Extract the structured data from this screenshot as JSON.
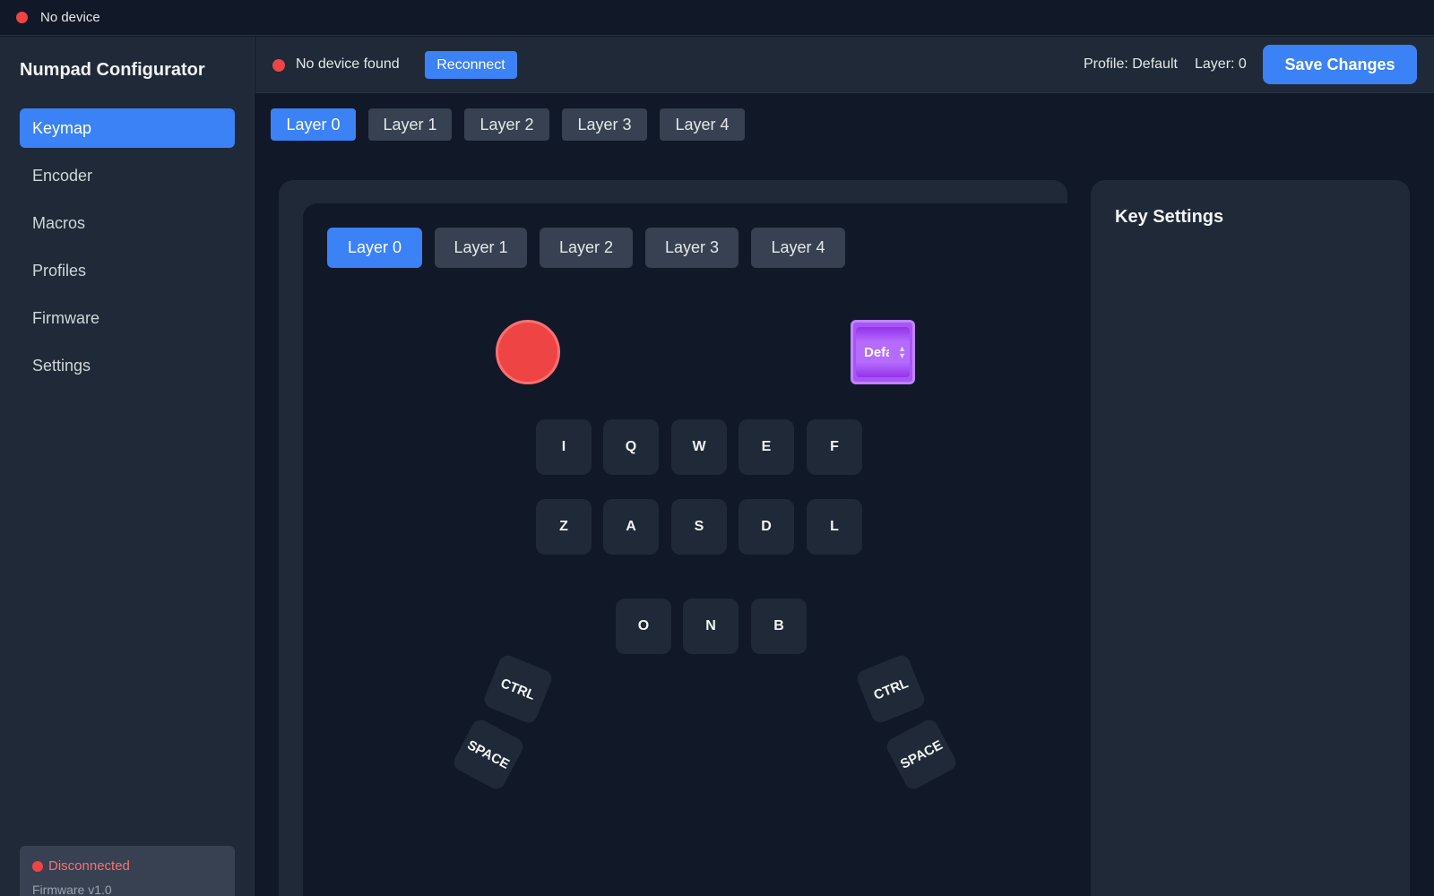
{
  "titlebar": {
    "status_text": "No device",
    "status_color": "#ef4444"
  },
  "sidebar": {
    "app_name": "Numpad Configurator",
    "items": [
      {
        "label": "Keymap",
        "active": true
      },
      {
        "label": "Encoder",
        "active": false
      },
      {
        "label": "Macros",
        "active": false
      },
      {
        "label": "Profiles",
        "active": false
      },
      {
        "label": "Firmware",
        "active": false
      },
      {
        "label": "Settings",
        "active": false
      }
    ],
    "connection_status": "Disconnected",
    "firmware_version": "Firmware v1.0"
  },
  "topbar": {
    "device_status": "No device found",
    "reconnect_label": "Reconnect",
    "profile_text": "Profile: Default",
    "layer_text": "Layer: 0",
    "save_label": "Save Changes"
  },
  "layer_tabs": [
    "Layer 0",
    "Layer 1",
    "Layer 2",
    "Layer 3",
    "Layer 4"
  ],
  "active_layer": 0,
  "editor": {
    "layer_tabs": [
      "Layer 0",
      "Layer 1",
      "Layer 2",
      "Layer 3",
      "Layer 4"
    ],
    "display_text": "Default",
    "keys_row1": [
      "I",
      "Q",
      "W",
      "E",
      "F"
    ],
    "keys_row2": [
      "Z",
      "A",
      "S",
      "D",
      "L"
    ],
    "keys_row3": [
      "O",
      "N",
      "B"
    ],
    "thumb_keys": {
      "left_top": "CTRL",
      "left_bottom": "SPACE",
      "right_top": "CTRL",
      "right_bottom": "SPACE"
    }
  },
  "key_settings": {
    "title": "Key Settings"
  },
  "colors": {
    "accent": "#3b82f6",
    "error": "#ef4444",
    "display": "#a855f7"
  }
}
